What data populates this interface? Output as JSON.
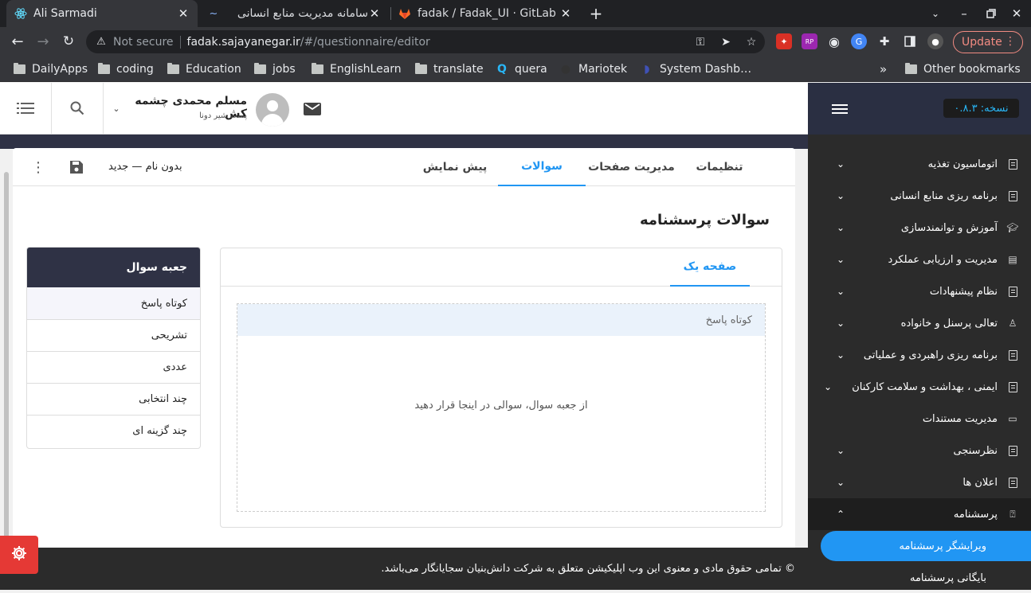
{
  "browser": {
    "tabs": [
      {
        "title": "Ali Sarmadi",
        "state": "active"
      },
      {
        "title": "سامانه مدیریت منابع انسانی",
        "state": "inactive"
      },
      {
        "title": "fadak / Fadak_UI · GitLab",
        "state": "inactive"
      }
    ],
    "not_secure": "Not secure",
    "url_host": "fadak.sajayanegar.ir",
    "url_path": "/#/questionnaire/editor",
    "update_label": "Update",
    "bookmarks": [
      "DailyApps",
      "coding",
      "Education",
      "jobs",
      "EnglishLearn",
      "translate",
      "quera",
      "Mariotek",
      "System Dashb…"
    ],
    "other_bookmarks": "Other bookmarks",
    "accent": "#f28b82"
  },
  "header": {
    "user_name": "مسلم محمدی چشمه کش",
    "user_role": "پست شیر دونا",
    "version": "نسخه: ۰.۸.۳"
  },
  "editor": {
    "tabs": [
      {
        "label": "تنظیمات"
      },
      {
        "label": "مدیریت صفحات"
      },
      {
        "label": "سوالات"
      },
      {
        "label": "پیش نمایش"
      }
    ],
    "form_name": "بدون نام — جدید",
    "page_title": "سوالات پرسشنامه",
    "question_box": {
      "title": "جعبه سوال",
      "items": [
        "کوتاه پاسخ",
        "تشریحی",
        "عددی",
        "چند انتخابی",
        "چند گزینه ای"
      ]
    },
    "page_tab": "صفحه یک",
    "dropzone_row": "کوتاه پاسخ",
    "dropzone_hint": "از جعبه سوال، سوالی در اینجا قرار دهید",
    "accent": "#2196f3"
  },
  "sidebar": {
    "items": [
      {
        "label": "اتوماسیون تغذیه"
      },
      {
        "label": "برنامه ریزی منابع انسانی"
      },
      {
        "label": "آموزش و توانمندسازی"
      },
      {
        "label": "مدیریت و ارزیابی عملکرد"
      },
      {
        "label": "نظام پیشنهادات"
      },
      {
        "label": "تعالی پرسنل و خانواده"
      },
      {
        "label": "برنامه ریزی راهبردی و عملیاتی"
      },
      {
        "label": "ایمنی ، بهداشت و سلامت کارکنان"
      },
      {
        "label": "مدیریت مستندات"
      },
      {
        "label": "نظرسنجی"
      },
      {
        "label": "اعلان ها"
      },
      {
        "label": "پرسشنامه"
      }
    ],
    "sub_items": [
      "ویرایشگر پرسشنامه",
      "بایگانی پرسشنامه"
    ]
  },
  "footer": {
    "copyright": "© تمامی حقوق مادی و معنوی این وب اپلیکیشن متعلق به شرکت دانش‌بنیان سجایانگار می‌باشد."
  }
}
